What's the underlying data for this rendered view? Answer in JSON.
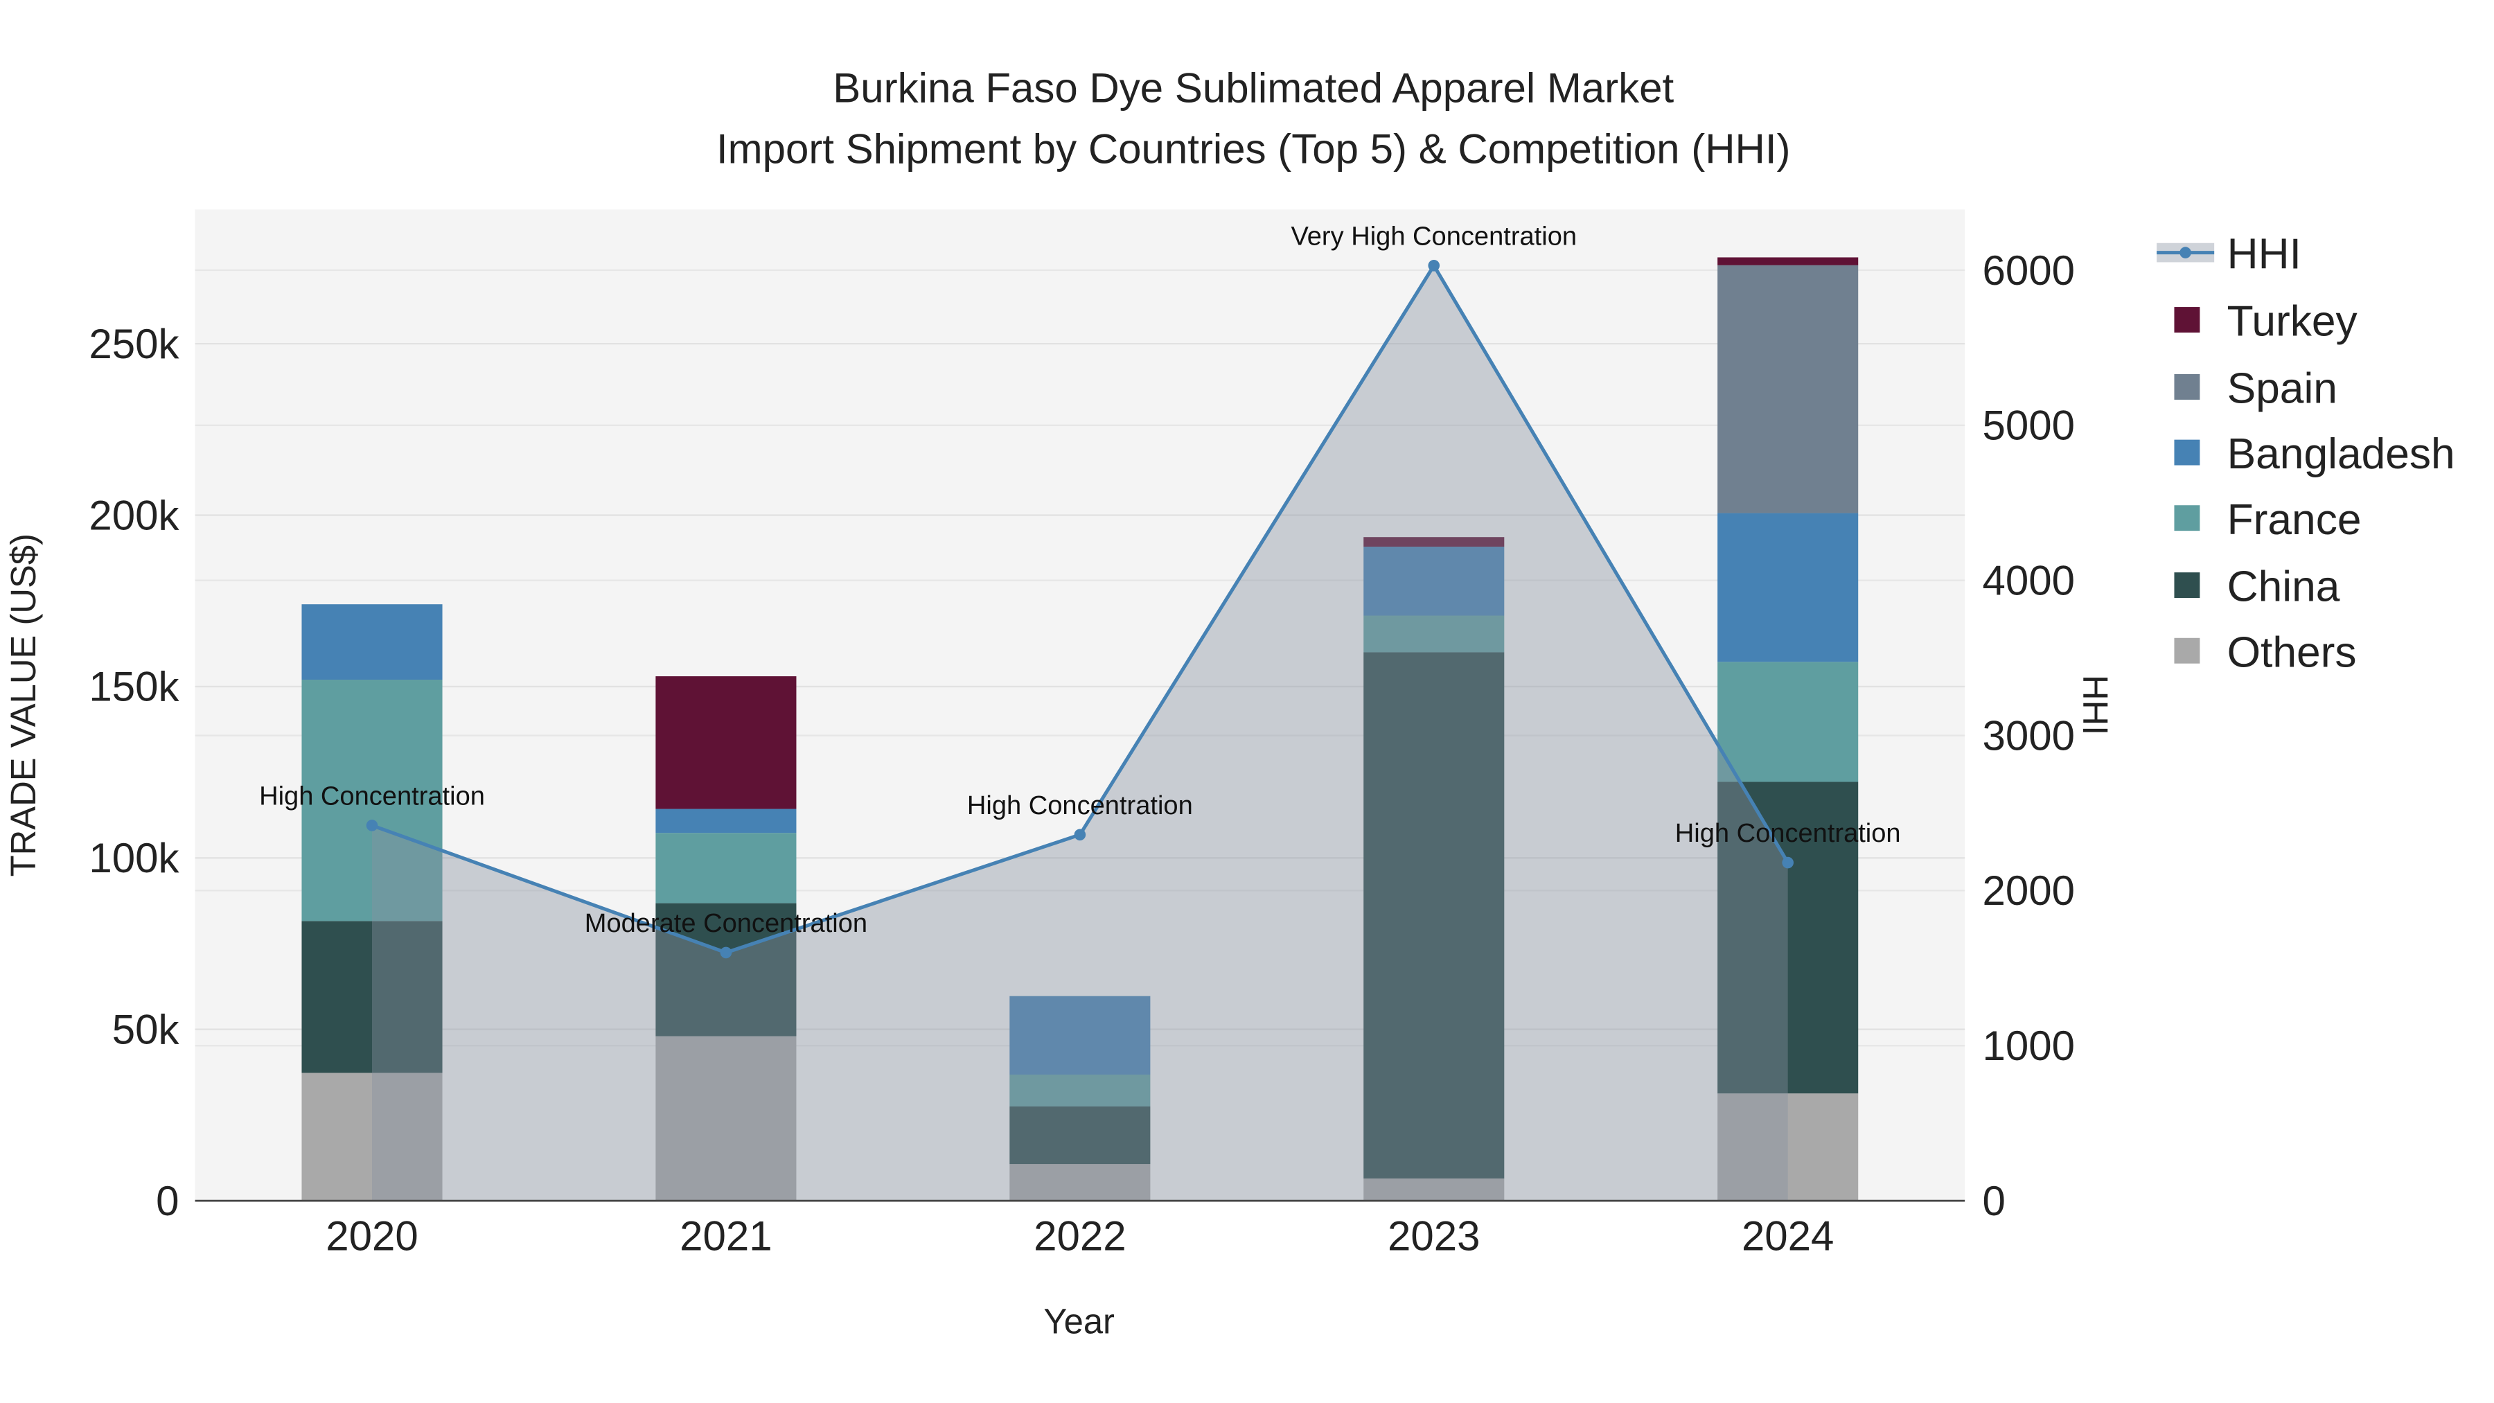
{
  "chart_data": {
    "type": "bar",
    "title_line1": "Burkina Faso Dye Sublimated Apparel Market",
    "title_line2": "Import Shipment by Countries (Top 5) & Competition (HHI)",
    "xlabel": "Year",
    "ylabel": "TRADE VALUE (US$)",
    "y2label": "HHI",
    "categories": [
      "2020",
      "2021",
      "2022",
      "2023",
      "2024"
    ],
    "ylim": [
      0,
      290000
    ],
    "y2lim": [
      0,
      6400
    ],
    "yticks": [
      0,
      50000,
      100000,
      150000,
      200000,
      250000
    ],
    "ytick_labels": [
      "0",
      "50k",
      "100k",
      "150k",
      "200k",
      "250k"
    ],
    "y2ticks": [
      0,
      1000,
      2000,
      3000,
      4000,
      5000,
      6000
    ],
    "y2tick_labels": [
      "0",
      "1000",
      "2000",
      "3000",
      "4000",
      "5000",
      "6000"
    ],
    "series": [
      {
        "name": "Others",
        "color": "#a9a9a9",
        "values": [
          37300,
          48000,
          10700,
          6500,
          31300
        ]
      },
      {
        "name": "China",
        "color": "#2f4f4f",
        "values": [
          44300,
          38800,
          16800,
          153500,
          90900
        ]
      },
      {
        "name": "France",
        "color": "#5f9ea0",
        "values": [
          70400,
          20500,
          9300,
          10700,
          35000
        ]
      },
      {
        "name": "Bangladesh",
        "color": "#4682b4",
        "values": [
          22000,
          7000,
          22900,
          20100,
          43400
        ]
      },
      {
        "name": "Spain",
        "color": "#708090",
        "values": [
          0,
          0,
          0,
          0,
          72300
        ]
      },
      {
        "name": "Turkey",
        "color": "#5f1235",
        "values": [
          0,
          38700,
          0,
          2800,
          2300
        ]
      }
    ],
    "hhi": {
      "name": "HHI",
      "color": "#4682b4",
      "values": [
        2420,
        1600,
        2360,
        6030,
        2180
      ],
      "annotations": [
        "High Concentration",
        "Moderate Concentration",
        "High Concentration",
        "Very High Concentration",
        "High Concentration"
      ]
    },
    "legend_order": [
      "HHI",
      "Turkey",
      "Spain",
      "Bangladesh",
      "France",
      "China",
      "Others"
    ],
    "legend_position": "right",
    "grid": true
  }
}
